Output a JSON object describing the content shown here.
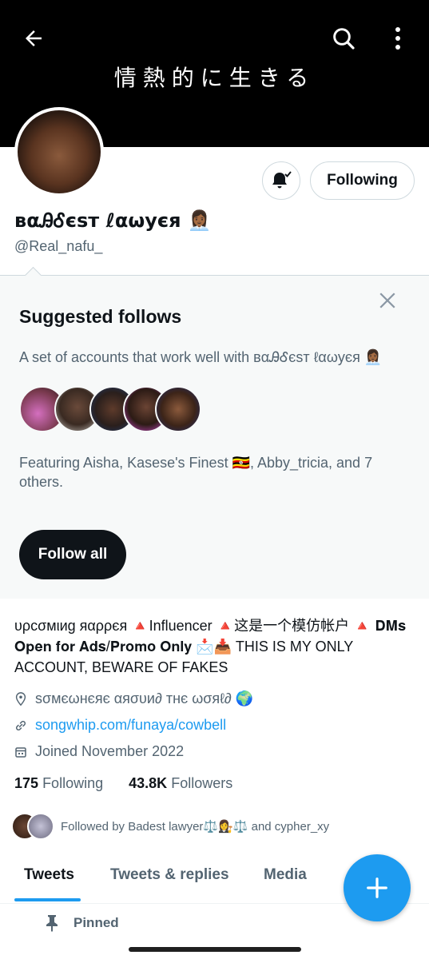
{
  "banner": {
    "text": "情熱的に生きる"
  },
  "header": {
    "back_icon": "arrow-left-icon",
    "search_icon": "search-icon",
    "more_icon": "more-vertical-icon"
  },
  "profile": {
    "display_name": "ʙαᎯᎴєѕт ℓαωуєя 👩🏾‍💼",
    "handle": "@Real_nafu_",
    "following_label": "Following",
    "bell_icon": "bell-check-icon"
  },
  "suggested": {
    "title": "Suggested follows",
    "description": "A set of accounts that work well with ʙαᎯᎴєѕт ℓαωуєя 👩🏾‍💼",
    "featuring": "Featuring Aisha, Kasese's Finest 🇺🇬, Abby_tricia, and 7 others.",
    "follow_all_label": "Follow all",
    "close_icon": "close-icon"
  },
  "bio": {
    "text": "υρcσмιиg яαρρєя 🔺Influencer 🔺这是一个模仿帐户 🔺 𝐃𝐌𝐬 𝐎𝐩𝐞𝐧 𝐟𝐨𝐫 𝐀𝐝𝐬/𝐏𝐫𝐨𝐦𝐨 𝐎𝐧𝐥𝐲 📩📥 THIS IS MY ONLY ACCOUNT, BEWARE OF FAKES"
  },
  "meta": {
    "location": "ѕσмєωнєяє αяσυи∂ тнє ωσяℓ∂ 🌍",
    "link": "songwhip.com/funaya/cowbell",
    "joined": "Joined November 2022"
  },
  "counts": {
    "following_count": "175",
    "following_label": "Following",
    "followers_count": "43.8K",
    "followers_label": "Followers"
  },
  "followed_by": {
    "text": "Followed by Badest lawyer⚖️👩‍⚖️⚖️ and cypher_xy"
  },
  "tabs": [
    {
      "label": "Tweets",
      "active": true
    },
    {
      "label": "Tweets & replies",
      "active": false
    },
    {
      "label": "Media",
      "active": false
    }
  ],
  "pinned": {
    "label": "Pinned"
  },
  "colors": {
    "accent": "#1d9bf0",
    "text": "#0f1419",
    "muted": "#536471",
    "panel": "#f7f9f9"
  }
}
